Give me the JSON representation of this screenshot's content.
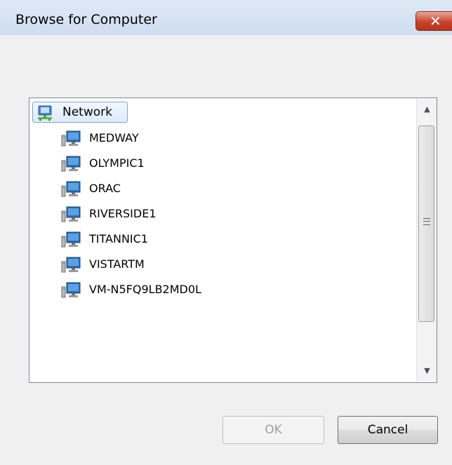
{
  "window": {
    "title": "Browse for Computer",
    "close_glyph": "✕"
  },
  "tree": {
    "root": {
      "label": "Network",
      "icon": "network-icon"
    },
    "items": [
      {
        "label": "MEDWAY",
        "icon": "computer-icon"
      },
      {
        "label": "OLYMPIC1",
        "icon": "computer-icon"
      },
      {
        "label": "ORAC",
        "icon": "computer-icon"
      },
      {
        "label": "RIVERSIDE1",
        "icon": "computer-icon"
      },
      {
        "label": "TITANNIC1",
        "icon": "computer-icon"
      },
      {
        "label": "VISTARTM",
        "icon": "computer-icon"
      },
      {
        "label": "VM-N5FQ9LB2MD0L",
        "icon": "computer-icon"
      }
    ]
  },
  "scrollbar": {
    "up_glyph": "▲",
    "down_glyph": "▼"
  },
  "buttons": {
    "ok_label": "OK",
    "cancel_label": "Cancel"
  },
  "colors": {
    "close_red": "#c7432b",
    "selection_border": "#7da2ce",
    "panel_border": "#828790"
  }
}
